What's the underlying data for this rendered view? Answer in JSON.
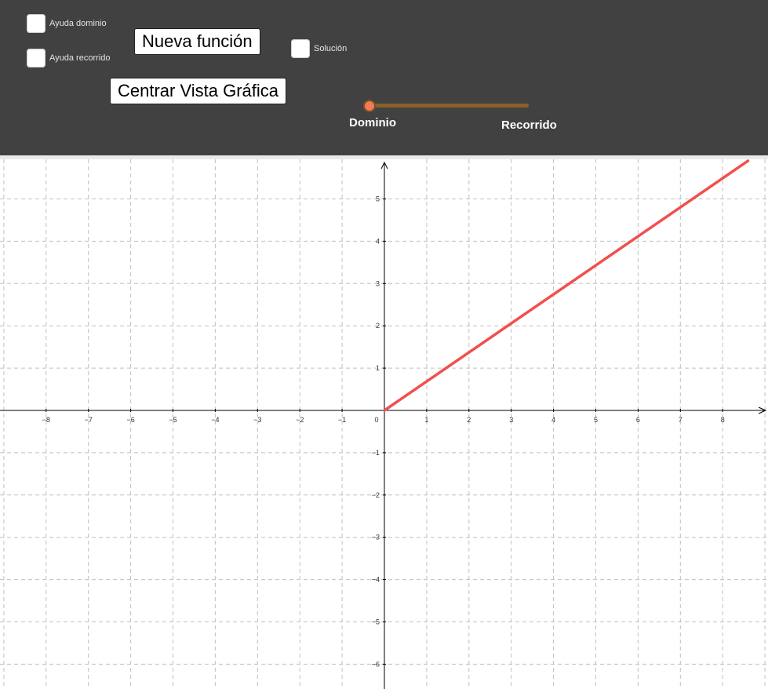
{
  "controls": {
    "help_domain_label": "Ayuda dominio",
    "help_range_label": "Ayuda recorrido",
    "solution_label": "Solución",
    "new_function_button": "Nueva función",
    "center_view_button": "Centrar Vista Gráfica",
    "slider": {
      "left_label": "Dominio",
      "right_label": "Recorrido",
      "value": 0,
      "min": 0,
      "max": 1
    }
  },
  "colors": {
    "toolbar_bg": "#414141",
    "function_line": "#f24f4f",
    "slider_track": "#8a6128",
    "slider_knob": "#f07a5a",
    "grid": "#c0c0c0",
    "axis": "#000000"
  },
  "chart_data": {
    "type": "line",
    "title": "",
    "xlabel": "",
    "ylabel": "",
    "xlim": [
      -9,
      9
    ],
    "ylim": [
      -6.5,
      5.8
    ],
    "x_ticks": [
      "−8",
      "−7",
      "−6",
      "−5",
      "−4",
      "−3",
      "−2",
      "−1",
      "0",
      "1",
      "2",
      "3",
      "4",
      "5",
      "6",
      "7",
      "8"
    ],
    "y_ticks": [
      "5",
      "4",
      "3",
      "2",
      "1",
      "−1",
      "−2",
      "−3",
      "−4",
      "−5",
      "−6"
    ],
    "grid": true,
    "series": [
      {
        "x": [
          0,
          8.6
        ],
        "y": [
          0,
          5.9
        ]
      }
    ]
  }
}
